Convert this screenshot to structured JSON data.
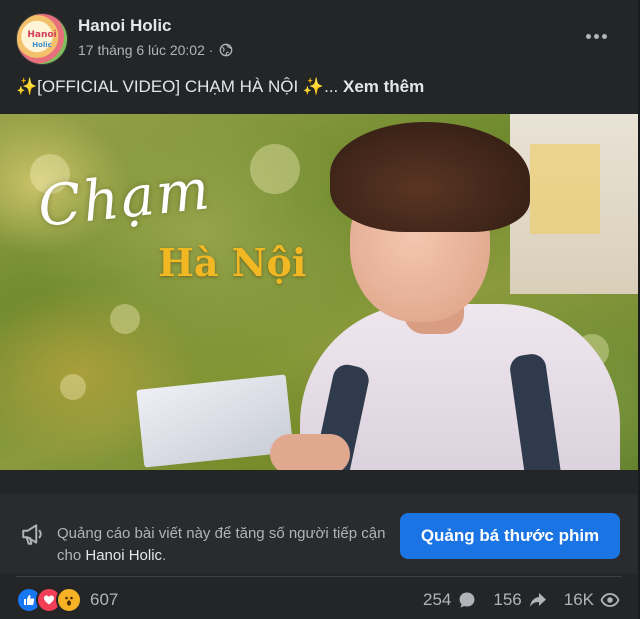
{
  "post": {
    "author": "Hanoi Holic",
    "avatar_text": [
      "Hanoi",
      "Holic"
    ],
    "timestamp": "17 tháng 6 lúc 20:02 ·",
    "caption_sparkle_left": "✨",
    "caption_text": "[OFFICIAL VIDEO] CHẠM HÀ NỘI",
    "caption_sparkle_right": "✨",
    "caption_ellipsis": "...",
    "see_more": "Xem thêm"
  },
  "video": {
    "title_script": "Chạm",
    "title_gold": "Hà Nội"
  },
  "promo": {
    "text_prefix": "Quảng cáo bài viết này để tăng số người tiếp cận cho ",
    "page_name": "Hanoi Holic",
    "text_suffix": ".",
    "button_label": "Quảng bá thước phim"
  },
  "engagement": {
    "reactions": [
      "like-icon",
      "love-icon",
      "wow-icon"
    ],
    "reaction_count": "607",
    "comments": "254",
    "shares": "156",
    "views": "16K"
  },
  "colors": {
    "background": "#242526",
    "primary_button": "#1b74e4",
    "title_gold": "#f2b824"
  }
}
